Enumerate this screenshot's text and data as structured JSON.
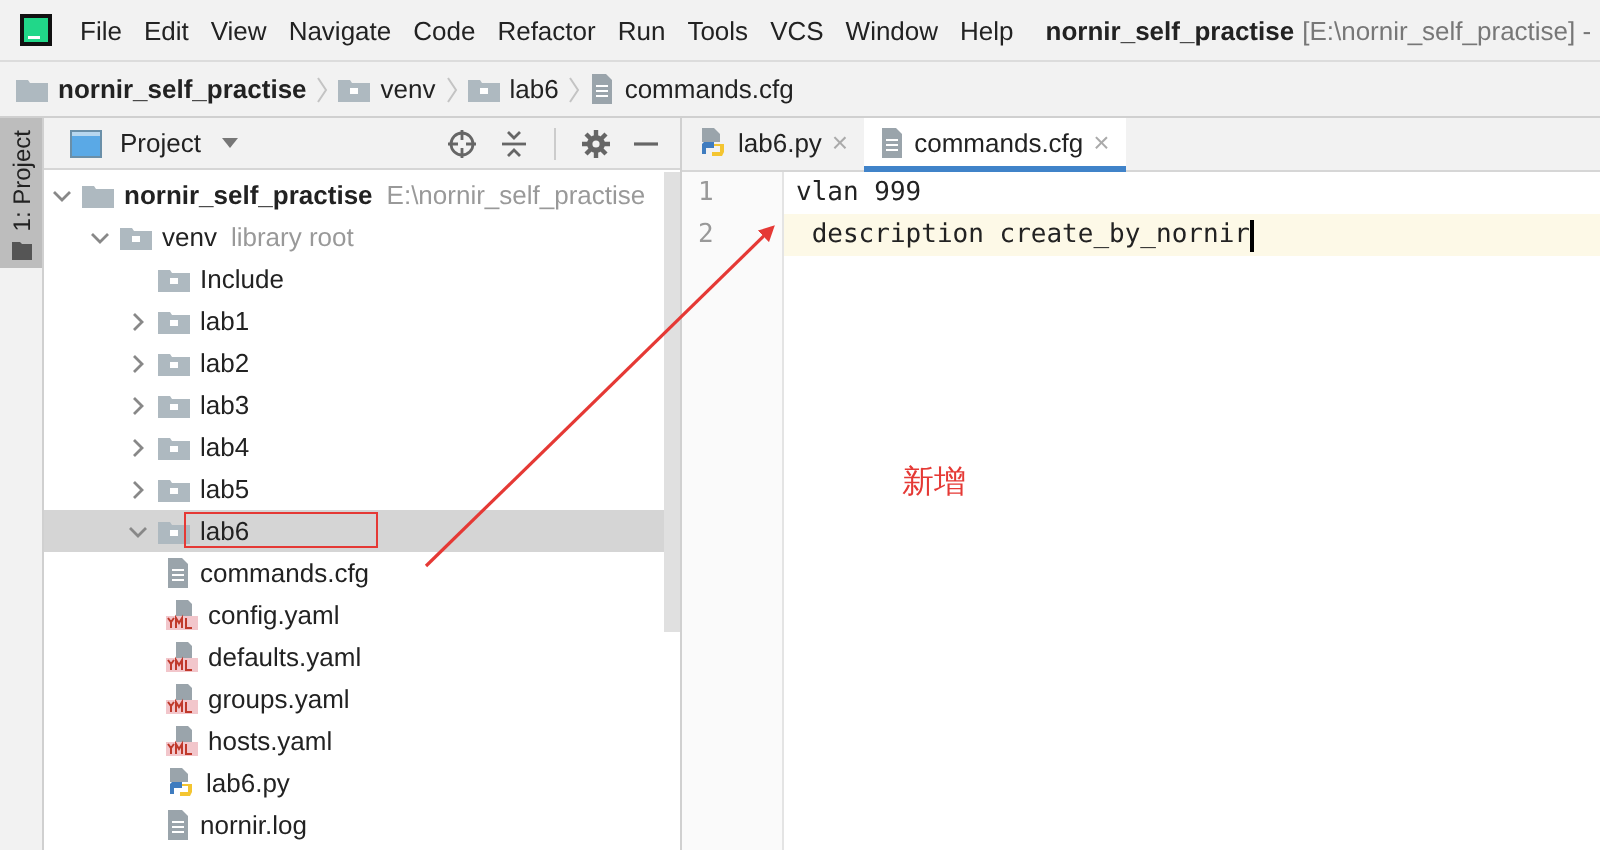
{
  "menu": [
    "File",
    "Edit",
    "View",
    "Navigate",
    "Code",
    "Refactor",
    "Run",
    "Tools",
    "VCS",
    "Window",
    "Help"
  ],
  "window": {
    "project": "nornir_self_practise",
    "path": "[E:\\nornir_self_practise] -"
  },
  "breadcrumb": [
    {
      "label": "nornir_self_practise",
      "kind": "project"
    },
    {
      "label": "venv",
      "kind": "folder"
    },
    {
      "label": "lab6",
      "kind": "folder"
    },
    {
      "label": "commands.cfg",
      "kind": "text"
    }
  ],
  "tool_strip": {
    "label": "1: Project",
    "selected": true
  },
  "project_panel": {
    "title": "Project",
    "tree": [
      {
        "label": "nornir_self_practise",
        "hint": "E:\\nornir_self_practise",
        "kind": "project",
        "expanded": true,
        "selected": false,
        "boxed": false,
        "children": [
          {
            "label": "venv",
            "hint": "library root",
            "kind": "folder",
            "expanded": true,
            "selected": false,
            "boxed": false,
            "children": [
              {
                "label": "Include",
                "kind": "leaf-folder",
                "selected": false,
                "boxed": false
              },
              {
                "label": "lab1",
                "kind": "folder",
                "expanded": false,
                "selected": false,
                "boxed": false
              },
              {
                "label": "lab2",
                "kind": "folder",
                "expanded": false,
                "selected": false,
                "boxed": false
              },
              {
                "label": "lab3",
                "kind": "folder",
                "expanded": false,
                "selected": false,
                "boxed": false
              },
              {
                "label": "lab4",
                "kind": "folder",
                "expanded": false,
                "selected": false,
                "boxed": false
              },
              {
                "label": "lab5",
                "kind": "folder",
                "expanded": false,
                "selected": false,
                "boxed": false
              },
              {
                "label": "lab6",
                "kind": "folder",
                "expanded": true,
                "selected": true,
                "boxed": true,
                "children": [
                  {
                    "label": "commands.cfg",
                    "kind": "text",
                    "selected": false,
                    "boxed": false
                  },
                  {
                    "label": "config.yaml",
                    "kind": "yaml",
                    "selected": false,
                    "boxed": false
                  },
                  {
                    "label": "defaults.yaml",
                    "kind": "yaml",
                    "selected": false,
                    "boxed": false
                  },
                  {
                    "label": "groups.yaml",
                    "kind": "yaml",
                    "selected": false,
                    "boxed": false
                  },
                  {
                    "label": "hosts.yaml",
                    "kind": "yaml",
                    "selected": false,
                    "boxed": false
                  },
                  {
                    "label": "lab6.py",
                    "kind": "python",
                    "selected": false,
                    "boxed": false
                  },
                  {
                    "label": "nornir.log",
                    "kind": "text",
                    "selected": false,
                    "boxed": false
                  }
                ]
              }
            ]
          }
        ]
      }
    ]
  },
  "editor": {
    "tabs": [
      {
        "label": "lab6.py",
        "kind": "python",
        "selected": false,
        "close": "×"
      },
      {
        "label": "commands.cfg",
        "kind": "text",
        "selected": true,
        "close": "×"
      }
    ],
    "lines": [
      {
        "number": "1",
        "text": "vlan 999",
        "current": false
      },
      {
        "number": "2",
        "text": " description create_by_nornir",
        "current": true
      }
    ]
  },
  "annotation": {
    "label": "新增"
  }
}
